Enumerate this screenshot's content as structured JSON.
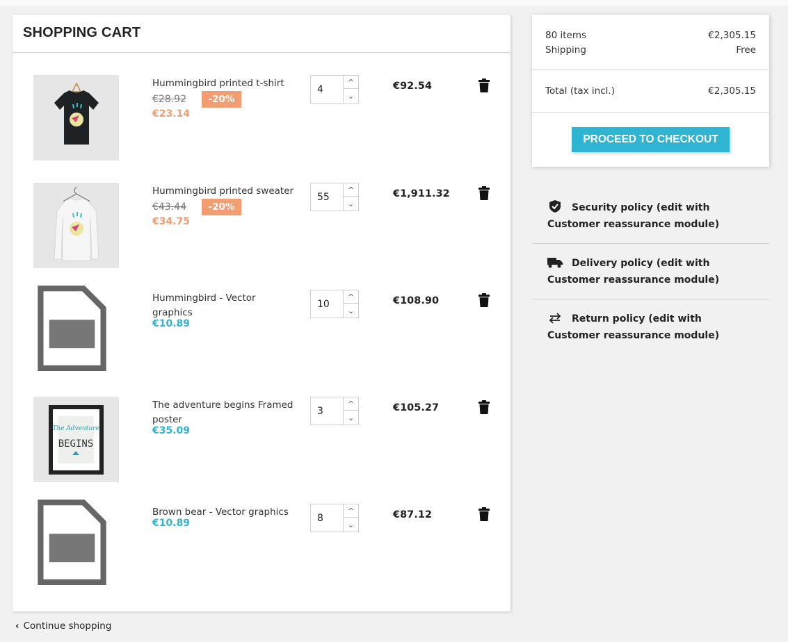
{
  "cart": {
    "title": "SHOPPING CART",
    "items": [
      {
        "name": "Hummingbird printed t-shirt",
        "regular_price": "€28.92",
        "discount": "-20%",
        "price": "€23.14",
        "quantity": "4",
        "line_total": "€92.54"
      },
      {
        "name": "Hummingbird printed sweater",
        "regular_price": "€43.44",
        "discount": "-20%",
        "price": "€34.75",
        "quantity": "55",
        "line_total": "€1,911.32"
      },
      {
        "name": "Hummingbird - Vector graphics",
        "price": "€10.89",
        "quantity": "10",
        "line_total": "€108.90"
      },
      {
        "name": "The adventure begins Framed poster",
        "price": "€35.09",
        "quantity": "3",
        "line_total": "€105.27"
      },
      {
        "name": "Brown bear - Vector graphics",
        "price": "€10.89",
        "quantity": "8",
        "line_total": "€87.12"
      }
    ],
    "continue_label": "Continue shopping"
  },
  "summary": {
    "items_label": "80 items",
    "items_value": "€2,305.15",
    "shipping_label": "Shipping",
    "shipping_value": "Free",
    "total_label": "Total (tax incl.)",
    "total_value": "€2,305.15",
    "checkout_label": "PROCEED TO CHECKOUT"
  },
  "reassurance": [
    {
      "icon": "shield-check-icon",
      "text": "Security policy (edit with Customer reassurance module)"
    },
    {
      "icon": "truck-icon",
      "text": "Delivery policy (edit with Customer reassurance module)"
    },
    {
      "icon": "swap-arrows-icon",
      "text": "Return policy (edit with Customer reassurance module)"
    }
  ],
  "colors": {
    "accent": "#2fb5d2",
    "discount": "#f39d72",
    "background": "#f1f1f1"
  }
}
